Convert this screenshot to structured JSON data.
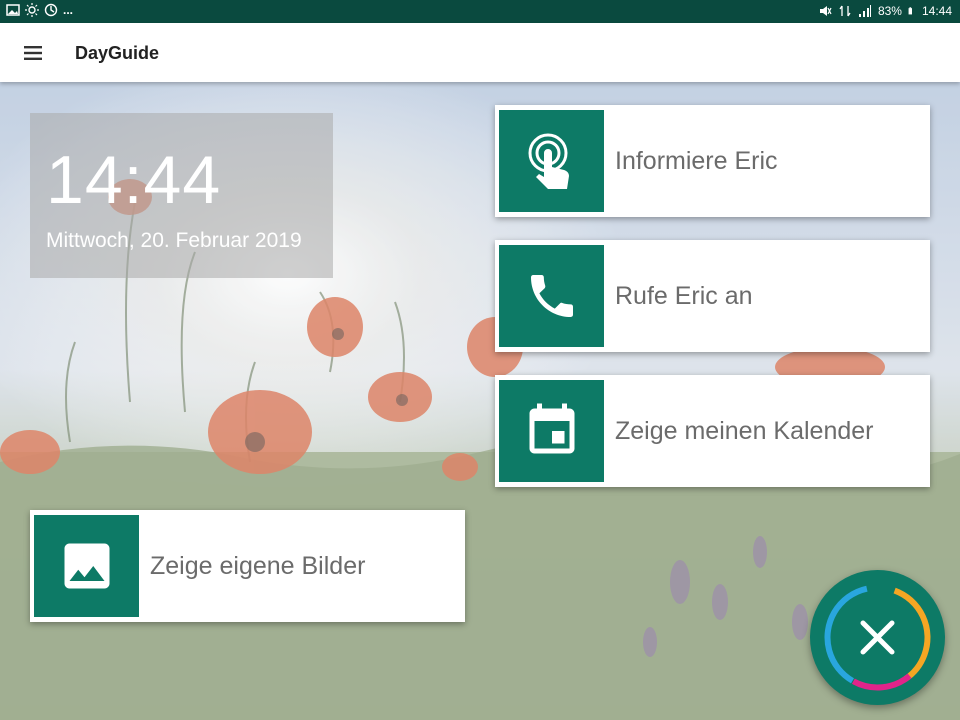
{
  "status_bar": {
    "left_icons": [
      "image-icon",
      "sun-icon",
      "sync-icon",
      "more-icon"
    ],
    "more_text": "...",
    "battery_percent": "83%",
    "time": "14:44"
  },
  "app_bar": {
    "title": "DayGuide"
  },
  "clock": {
    "time": "14:44",
    "date": "Mittwoch, 20. Februar 2019"
  },
  "actions": [
    {
      "label": "Informiere Eric",
      "icon": "touch-icon"
    },
    {
      "label": "Rufe Eric an",
      "icon": "phone-icon"
    },
    {
      "label": "Zeige meinen Kalender",
      "icon": "calendar-icon"
    },
    {
      "label": "Zeige eigene Bilder",
      "icon": "image-icon"
    }
  ],
  "colors": {
    "accent": "#0d7a66",
    "status_bar": "#0a4a3f"
  }
}
